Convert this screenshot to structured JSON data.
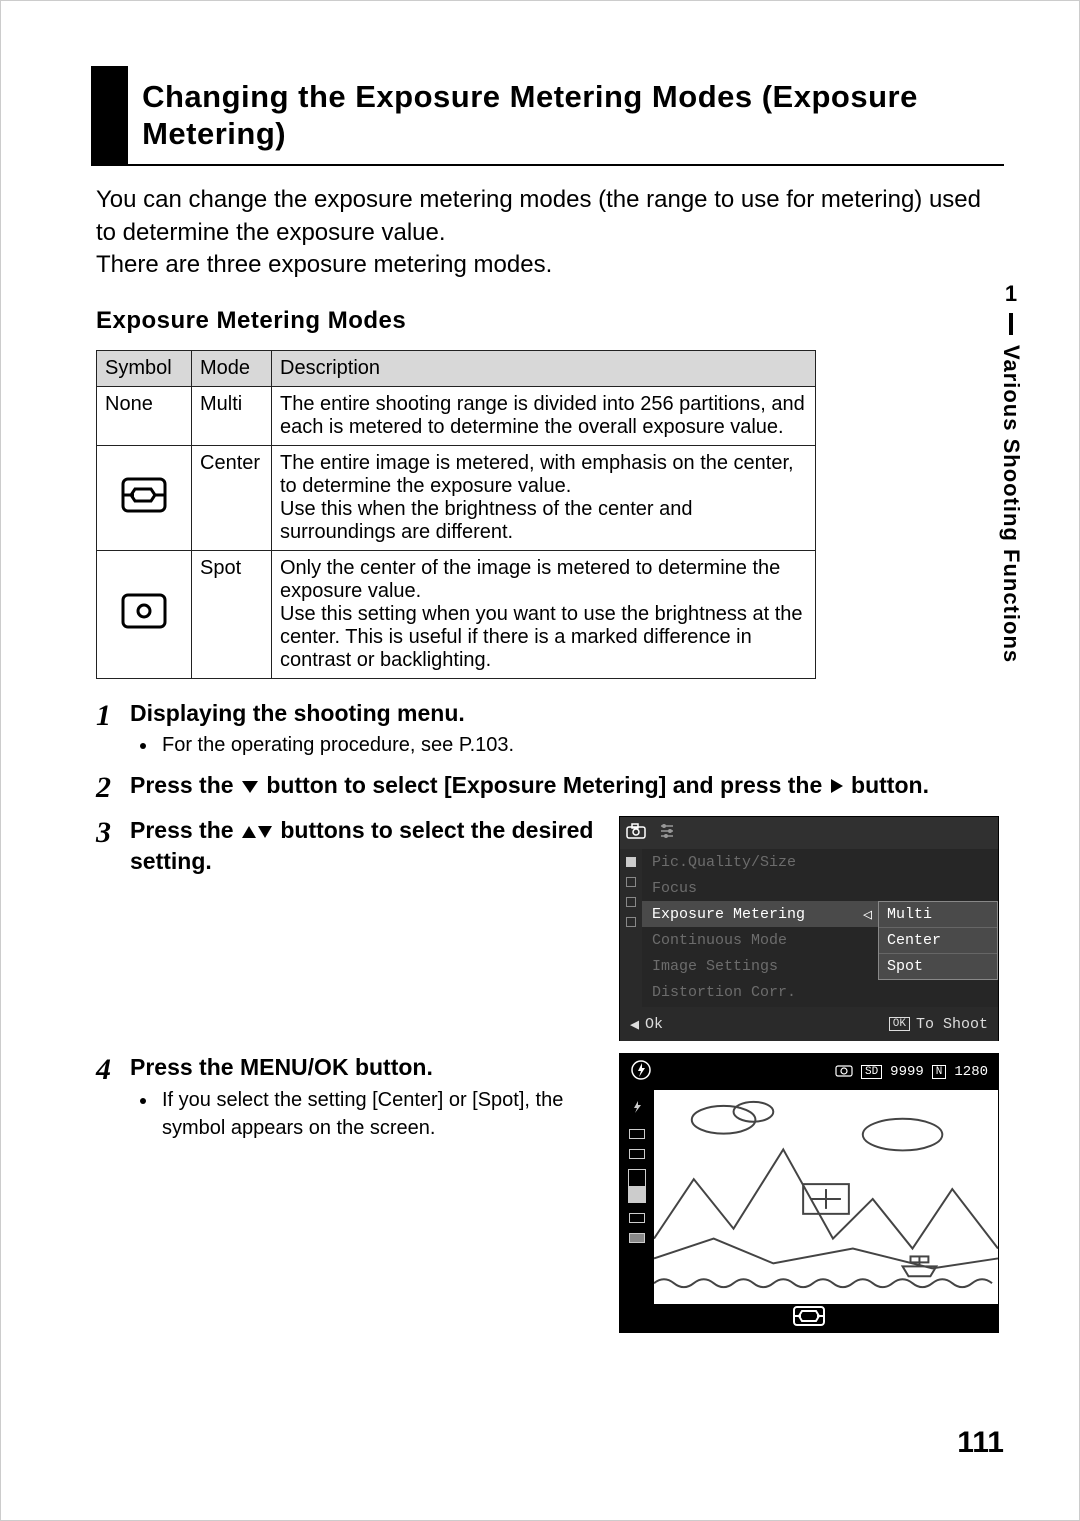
{
  "title": "Changing the Exposure Metering Modes (Exposure Metering)",
  "intro": "You can change the exposure metering modes (the range to use for metering) used to determine the exposure value.\nThere are three exposure metering modes.",
  "subhead": "Exposure Metering Modes",
  "table": {
    "headers": [
      "Symbol",
      "Mode",
      "Description"
    ],
    "rows": [
      {
        "symbol": "None",
        "symbol_is_text": true,
        "mode": "Multi",
        "desc": "The entire shooting range is divided into 256 partitions, and each is metered to determine the overall exposure value."
      },
      {
        "symbol": "center-weighted-icon",
        "symbol_is_text": false,
        "mode": "Center",
        "desc": "The entire image is metered, with emphasis on the center, to determine the exposure value.\nUse this when the brightness of the center and surroundings are different."
      },
      {
        "symbol": "spot-icon",
        "symbol_is_text": false,
        "mode": "Spot",
        "desc": "Only the center of the image is metered to determine the exposure value.\nUse this setting when you want to use the brightness at the center. This is useful if there is a marked difference in contrast or backlighting."
      }
    ]
  },
  "steps": [
    {
      "num": "1",
      "title": "Displaying the shooting menu.",
      "bullets": [
        "For the operating procedure, see P.103."
      ]
    },
    {
      "num": "2",
      "title_parts": [
        "Press the ",
        "▼",
        " button to select [Exposure Metering] and press the ",
        "▶",
        " button."
      ]
    },
    {
      "num": "3",
      "title_parts": [
        "Press the ",
        "▲▼",
        " buttons to select the desired setting."
      ]
    },
    {
      "num": "4",
      "title": "Press the MENU/OK button.",
      "bullets": [
        "If you select the setting [Center] or [Spot], the symbol appears on the screen."
      ]
    }
  ],
  "menu": {
    "items": [
      {
        "label": "Pic.Quality/Size",
        "highlight": false
      },
      {
        "label": "Focus",
        "highlight": false
      },
      {
        "label": "Exposure Metering",
        "highlight": true
      },
      {
        "label": "Continuous Mode",
        "highlight": false
      },
      {
        "label": "Image Settings",
        "highlight": false
      },
      {
        "label": "Distortion Corr.",
        "highlight": false
      }
    ],
    "options": [
      "Multi",
      "Center",
      "Spot"
    ],
    "foot_left_symbol": "◀",
    "foot_left": "Ok",
    "foot_right_box": "OK",
    "foot_right": "To Shoot"
  },
  "liveview": {
    "sd_label": "SD",
    "shots": "9999",
    "size_badge": "N",
    "size": "1280"
  },
  "side": {
    "chapter": "1",
    "label": "Various Shooting Functions"
  },
  "page_number": "111"
}
